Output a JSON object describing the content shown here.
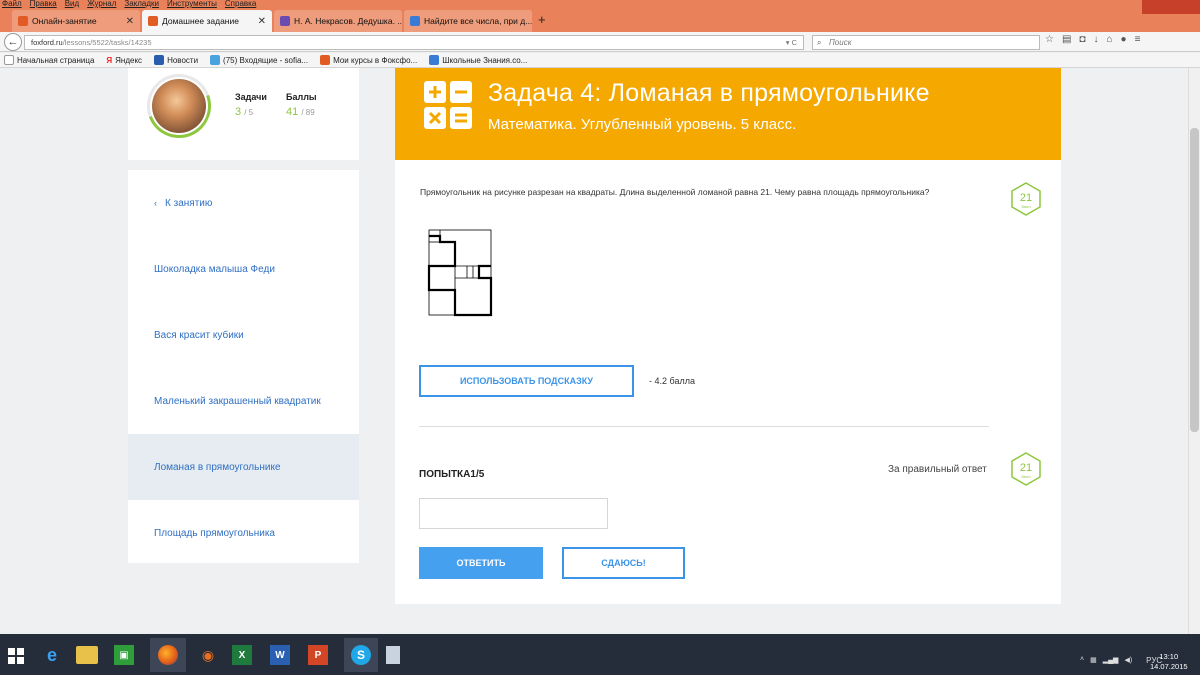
{
  "browser": {
    "menu": [
      "Файл",
      "Правка",
      "Вид",
      "Журнал",
      "Закладки",
      "Инструменты",
      "Справка"
    ],
    "tabs": [
      {
        "label": "Онлайн-занятие",
        "active": false
      },
      {
        "label": "Домашнее задание",
        "active": true
      },
      {
        "label": "Н. А. Некрасов. Дедушка. ...",
        "active": false
      },
      {
        "label": "Найдите все числа, при д...",
        "active": false
      }
    ],
    "new_tab": "+",
    "url_host": "foxford.ru",
    "url_path": "/lessons/5522/tasks/14235",
    "search_placeholder": "Поиск",
    "bookmarks": [
      {
        "label": "Начальная страница"
      },
      {
        "label": "Яндекс"
      },
      {
        "label": "Новости"
      },
      {
        "label": "(75) Входящие - sofia..."
      },
      {
        "label": "Мои курсы в Фоксфо..."
      },
      {
        "label": "Школьные Знания.co..."
      }
    ]
  },
  "profile": {
    "tasks_label": "Задачи",
    "tasks_done": "3",
    "tasks_total": "/ 5",
    "points_label": "Баллы",
    "points_done": "41",
    "points_total": "/ 89"
  },
  "nav": {
    "back": "К занятию",
    "items": [
      {
        "label": "Шоколадка малыша Феди",
        "active": false
      },
      {
        "label": "Вася красит кубики",
        "active": false
      },
      {
        "label": "Маленький закрашенный квадратик",
        "active": false
      },
      {
        "label": "Ломаная в прямоугольнике",
        "active": true
      },
      {
        "label": "Площадь прямоугольника",
        "active": false
      }
    ]
  },
  "task": {
    "title": "Задача 4: Ломаная в прямоугольнике",
    "subtitle": "Математика. Углубленный уровень. 5 класс.",
    "question": "Прямоугольник на рисунке разрезан на квадраты. Длина выделенной ломаной равна 21. Чему равна площадь прямоугольника?",
    "points": "21",
    "points_unit": "балл",
    "hint_button": "ИСПОЛЬЗОВАТЬ ПОДСКАЗКУ",
    "hint_cost": "- 4.2 балла",
    "attempt": "ПОПЫТКА1/5",
    "correct_label": "За правильный ответ",
    "answer_value": "",
    "submit_button": "ОТВЕТИТЬ",
    "giveup_button": "СДАЮСЬ!"
  },
  "taskbar": {
    "lang": "РУС",
    "time": "13:10",
    "date": "14.07.2015"
  },
  "colors": {
    "banner": "#f5a800",
    "accent_blue": "#3b94e8",
    "green": "#8dc63f",
    "titlebar": "#e9825a"
  }
}
